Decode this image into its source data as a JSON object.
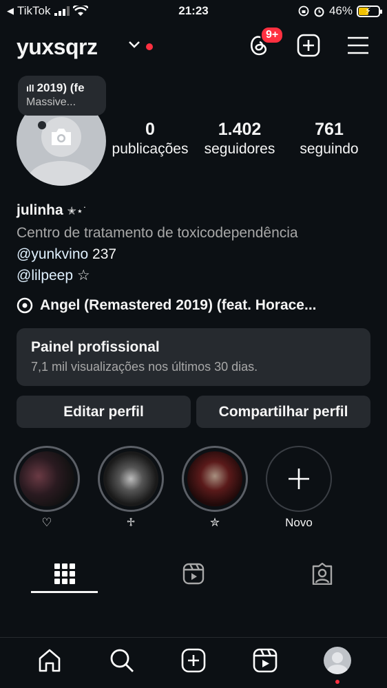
{
  "status_bar": {
    "back_app": "TikTok",
    "time": "21:23",
    "battery": "46%"
  },
  "header": {
    "username": "yuxsqrz",
    "notification_count": "9+"
  },
  "note": {
    "line1": "2019) (fe",
    "line2": "Massive..."
  },
  "stats": [
    {
      "value": "0",
      "label": "publicações"
    },
    {
      "value": "1.402",
      "label": "seguidores"
    },
    {
      "value": "761",
      "label": "seguindo"
    }
  ],
  "bio": {
    "name": "julinha",
    "name_decoration": "✭⋆˙",
    "category": "Centro de tratamento de toxicodependência",
    "line1_mention": "@yunkvino",
    "line1_text": " 237",
    "line2_mention": "@lilpeep",
    "line2_text": " ☆"
  },
  "music": {
    "track": "Angel (Remastered 2019) (feat. Horace..."
  },
  "dashboard": {
    "title": "Painel profissional",
    "subtitle": "7,1 mil visualizações nos últimos 30 dias."
  },
  "buttons": {
    "edit": "Editar perfil",
    "share": "Compartilhar perfil"
  },
  "highlights": [
    {
      "label": "♡"
    },
    {
      "label": "♱"
    },
    {
      "label": "✮"
    },
    {
      "label": "Novo"
    }
  ],
  "colors": {
    "background": "#0c1014",
    "surface": "#262a2f",
    "accent_red": "#ff3040",
    "mention": "#e0f1ff"
  }
}
